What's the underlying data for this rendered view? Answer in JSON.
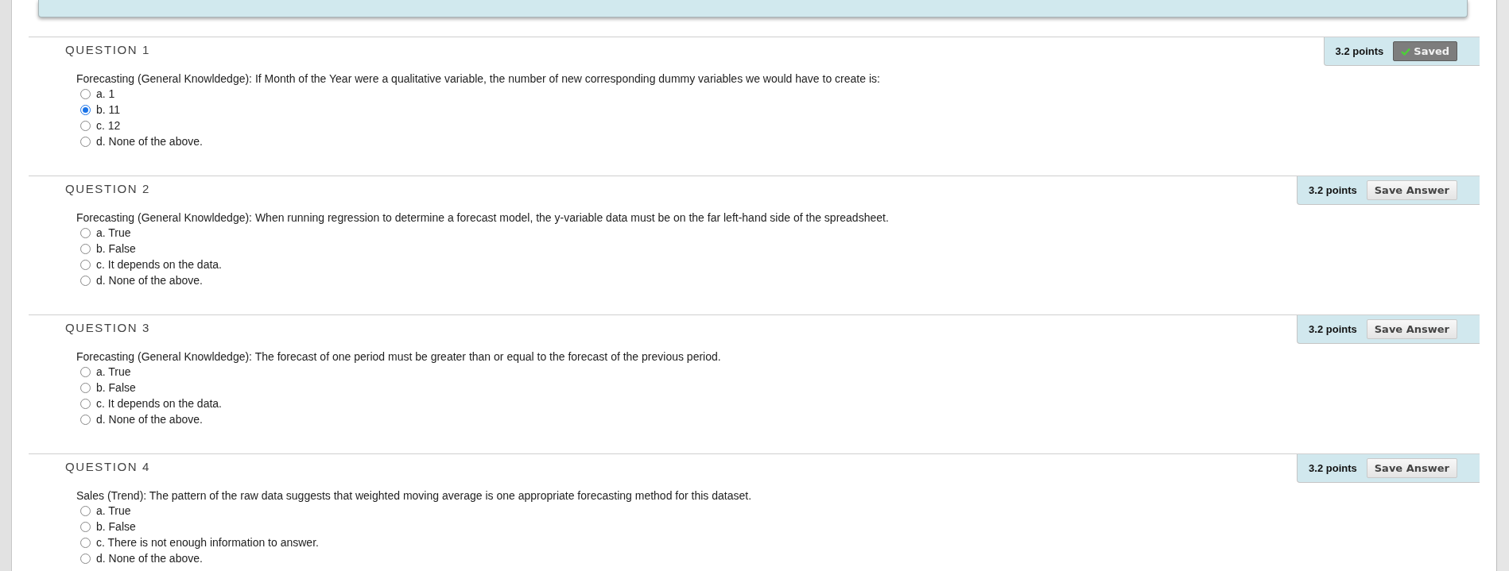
{
  "questions": [
    {
      "title": "QUESTION 1",
      "points": "3.2 points",
      "saved": true,
      "button_label": "Saved",
      "text": "Forecasting (General Knowldedge): If Month of the Year were a qualitative variable, the number of new corresponding dummy variables we would have to create is:",
      "options": [
        {
          "label": "a. 1",
          "selected": false
        },
        {
          "label": "b. 11",
          "selected": true
        },
        {
          "label": "c. 12",
          "selected": false
        },
        {
          "label": "d. None of the above.",
          "selected": false
        }
      ]
    },
    {
      "title": "QUESTION 2",
      "points": "3.2 points",
      "saved": false,
      "button_label": "Save Answer",
      "text": "Forecasting (General Knowldedge): When running regression to determine a forecast model, the y-variable data must be on the far left-hand side of the spreadsheet.",
      "options": [
        {
          "label": "a. True",
          "selected": false
        },
        {
          "label": "b. False",
          "selected": false
        },
        {
          "label": "c. It depends on the data.",
          "selected": false
        },
        {
          "label": "d. None of the above.",
          "selected": false
        }
      ]
    },
    {
      "title": "QUESTION 3",
      "points": "3.2 points",
      "saved": false,
      "button_label": "Save Answer",
      "text": "Forecasting (General Knowldedge): The forecast of one period must be greater than or equal to the forecast of the previous period.",
      "options": [
        {
          "label": "a. True",
          "selected": false
        },
        {
          "label": "b. False",
          "selected": false
        },
        {
          "label": "c. It depends on the data.",
          "selected": false
        },
        {
          "label": "d. None of the above.",
          "selected": false
        }
      ]
    },
    {
      "title": "QUESTION 4",
      "points": "3.2 points",
      "saved": false,
      "button_label": "Save Answer",
      "text": "Sales (Trend): The pattern of the raw data suggests that weighted moving average is one appropriate forecasting method for this dataset.",
      "options": [
        {
          "label": "a. True",
          "selected": false
        },
        {
          "label": "b. False",
          "selected": false
        },
        {
          "label": "c. There is not enough information to answer.",
          "selected": false
        },
        {
          "label": "d. None of the above.",
          "selected": false
        }
      ]
    }
  ]
}
